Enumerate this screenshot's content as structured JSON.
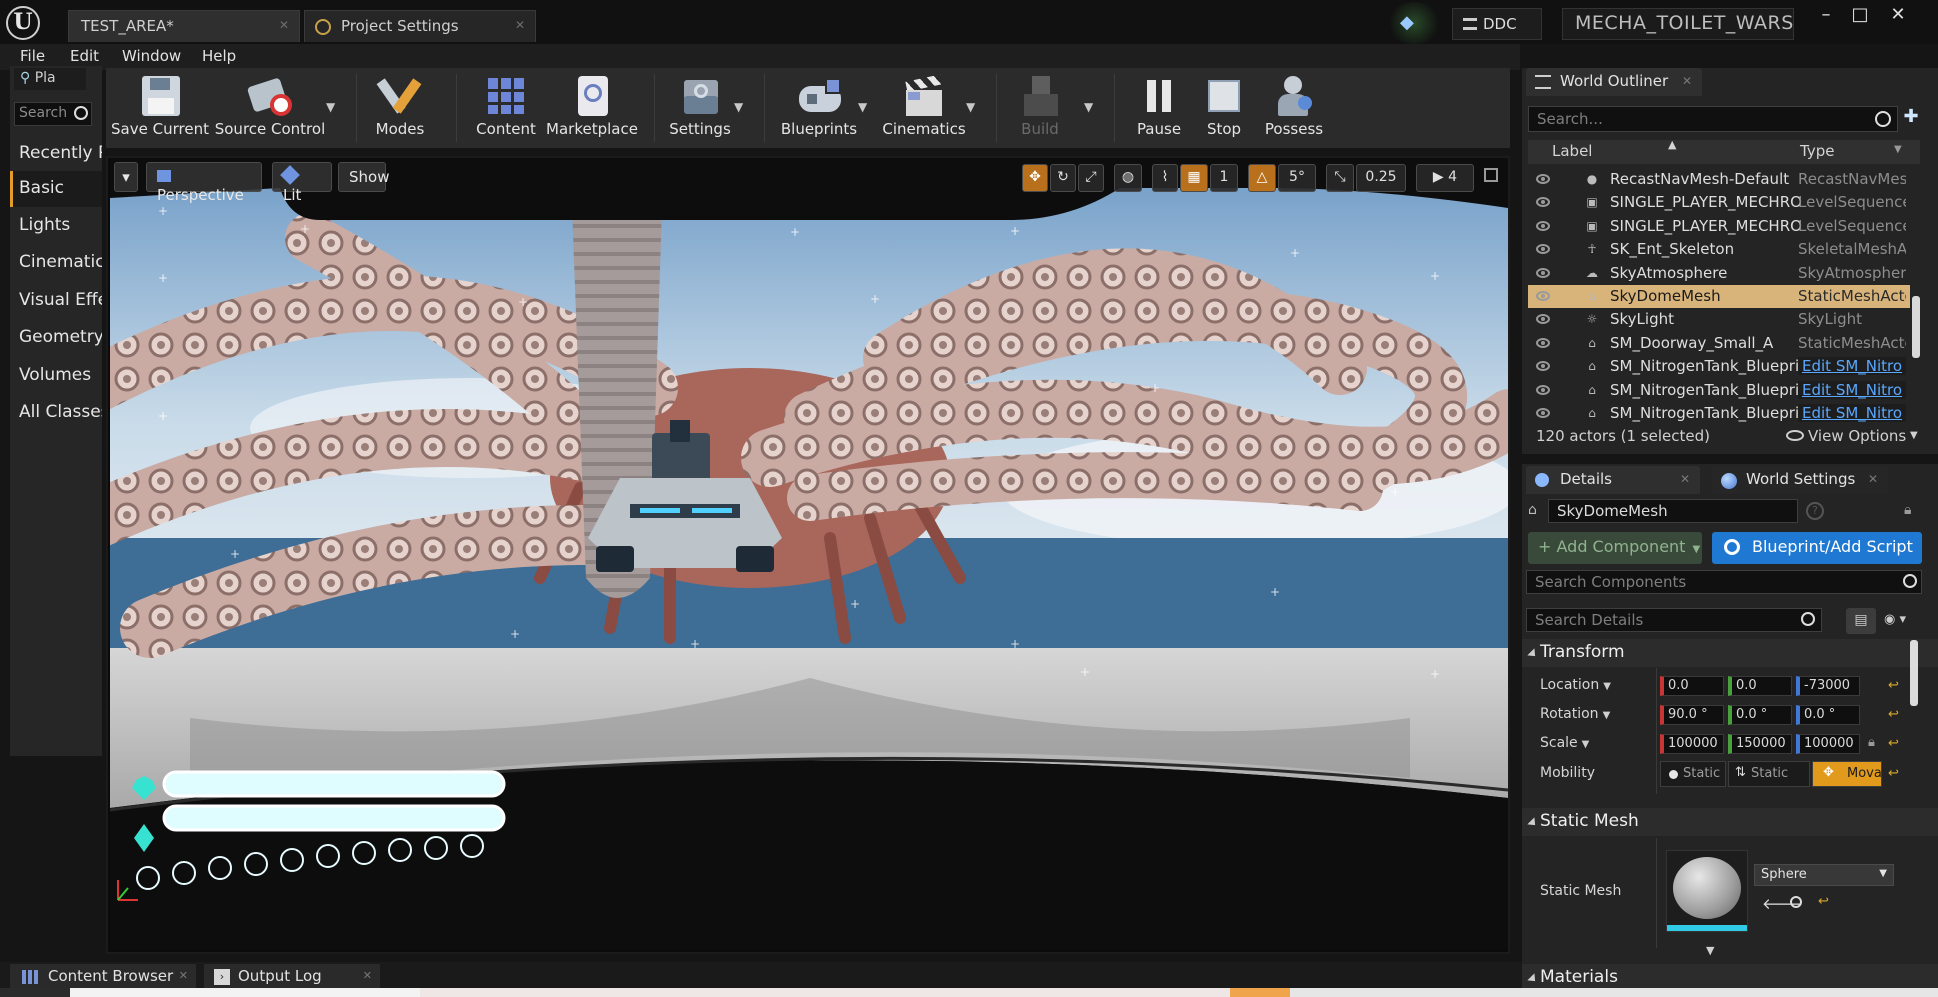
{
  "window": {
    "tabs": [
      {
        "label": "TEST_AREA*"
      },
      {
        "label": "Project Settings"
      }
    ],
    "ddc_label": "DDC",
    "project_name": "MECHA_TOILET_WARS",
    "controls": {
      "minimize": "–",
      "maximize": "□",
      "close": "✕"
    }
  },
  "menu": [
    "File",
    "Edit",
    "Window",
    "Help"
  ],
  "modes": {
    "tab_label": "Pla",
    "search_placeholder": "Search",
    "categories": [
      "Recently Placed",
      "Basic",
      "Lights",
      "Cinematic",
      "Visual Effects",
      "Geometry",
      "Volumes",
      "All Classes"
    ],
    "selected": "Basic"
  },
  "toolbar": {
    "buttons": [
      {
        "label": "Save Current",
        "icon": "save-icon"
      },
      {
        "label": "Source Control",
        "icon": "source-control-icon"
      },
      {
        "label": "Modes",
        "icon": "modes-icon"
      },
      {
        "label": "Content",
        "icon": "content-icon"
      },
      {
        "label": "Marketplace",
        "icon": "marketplace-icon"
      },
      {
        "label": "Settings",
        "icon": "settings-icon"
      },
      {
        "label": "Blueprints",
        "icon": "blueprints-icon"
      },
      {
        "label": "Cinematics",
        "icon": "cinematics-icon"
      },
      {
        "label": "Build",
        "icon": "build-icon",
        "disabled": true
      },
      {
        "label": "Pause",
        "icon": "pause-icon"
      },
      {
        "label": "Stop",
        "icon": "stop-icon"
      },
      {
        "label": "Possess",
        "icon": "possess-icon"
      }
    ]
  },
  "viewport": {
    "view_mode": "Perspective",
    "lighting": "Lit",
    "show_label": "Show",
    "rotation_snap": "5°",
    "scale_snap": "0.25",
    "camera_speed": "4",
    "colors": {
      "sky_top": "#7ea8cf",
      "sea": "#3f6f98",
      "floor": "#cfcfcf",
      "tentacle": "#c8a8a3",
      "hud_bar": "#dffcff",
      "hud_accent": "#37e3d0"
    }
  },
  "outliner": {
    "title": "World Outliner",
    "search_placeholder": "Search...",
    "columns": {
      "label": "Label",
      "type": "Type"
    },
    "rows": [
      {
        "label": "RecastNavMesh-Default",
        "type": "RecastNavMes",
        "icon": "sphere-icon"
      },
      {
        "label": "SINGLE_PLAYER_MECHRO",
        "type": "LevelSequence",
        "icon": "sequence-icon"
      },
      {
        "label": "SINGLE_PLAYER_MECHRO",
        "type": "LevelSequence",
        "icon": "sequence-icon"
      },
      {
        "label": "SK_Ent_Skeleton",
        "type": "SkeletalMeshA",
        "icon": "skeleton-icon"
      },
      {
        "label": "SkyAtmosphere",
        "type": "SkyAtmospher",
        "icon": "atmosphere-icon"
      },
      {
        "label": "SkyDomeMesh",
        "type": "StaticMeshActo",
        "icon": "mesh-icon",
        "selected": true
      },
      {
        "label": "SkyLight",
        "type": "SkyLight",
        "icon": "skylight-icon"
      },
      {
        "label": "SM_Doorway_Small_A",
        "type": "StaticMeshActo",
        "icon": "mesh-icon"
      },
      {
        "label": "SM_NitrogenTank_Blueprint",
        "type": "Edit SM_Nitro",
        "icon": "mesh-icon",
        "link": true
      },
      {
        "label": "SM_NitrogenTank_Blueprint",
        "type": "Edit SM_Nitro",
        "icon": "mesh-icon",
        "link": true
      },
      {
        "label": "SM_NitrogenTank_Blueprint",
        "type": "Edit SM_Nitro",
        "icon": "mesh-icon",
        "link": true
      }
    ],
    "footer_count": "120 actors (1 selected)",
    "view_options": "View Options"
  },
  "details": {
    "tabs": [
      {
        "label": "Details"
      },
      {
        "label": "World Settings"
      }
    ],
    "actor_name": "SkyDomeMesh",
    "add_component": "+ Add Component",
    "blueprint_button": "Blueprint/Add Script",
    "search_components_placeholder": "Search Components",
    "search_details_placeholder": "Search Details",
    "transform": {
      "title": "Transform",
      "location_label": "Location",
      "location": [
        "0.0",
        "0.0",
        "-73000"
      ],
      "rotation_label": "Rotation",
      "rotation": [
        "90.0 °",
        "0.0 °",
        "0.0 °"
      ],
      "scale_label": "Scale",
      "scale": [
        "100000",
        "150000",
        "100000"
      ],
      "mobility_label": "Mobility",
      "mobility": [
        "Static",
        "Static",
        "Movable"
      ],
      "mobility_selected": "Movable"
    },
    "static_mesh": {
      "title": "Static Mesh",
      "label": "Static Mesh",
      "value": "Sphere"
    },
    "materials_title": "Materials"
  },
  "bottom_tabs": [
    {
      "label": "Content Browser"
    },
    {
      "label": "Output Log"
    }
  ]
}
